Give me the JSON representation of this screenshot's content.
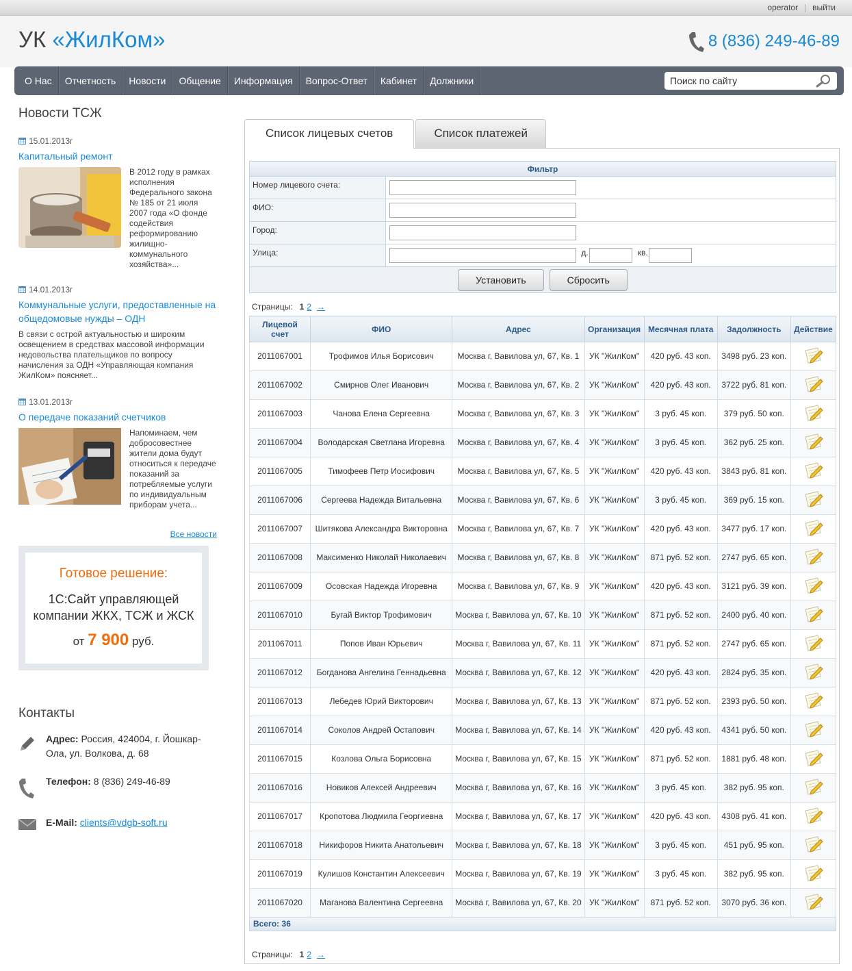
{
  "topbar": {
    "user": "operator",
    "logout": "выйти"
  },
  "logo": {
    "prefix": "УК",
    "name": "«ЖилКом»"
  },
  "header": {
    "phone": "8 (836) 249-46-89"
  },
  "nav": [
    "О Нас",
    "Отчетность",
    "Новости",
    "Общение",
    "Информация",
    "Вопрос-Ответ",
    "Кабинет",
    "Должники"
  ],
  "search": {
    "placeholder": "Поиск по сайту"
  },
  "news_section": {
    "title": "Новости ТСЖ",
    "all_link": "Все новости"
  },
  "news": [
    {
      "date": "15.01.2013г",
      "title": "Капитальный ремонт",
      "text": "В 2012 году в рамках исполнения Федерального закона № 185 от 21 июля 2007 года «О фонде содействия реформированию жилищно-коммунального хозяйства»..."
    },
    {
      "date": "14.01.2013г",
      "title": "Коммунальные услуги, предоставленные на общедомовые нужды – ОДН",
      "text": "В связи с острой актуальностью и широким освещением в средствах массовой информации недовольства плательщиков по вопросу начисления за ОДН «Управляющая компания ЖилКом» поясняет..."
    },
    {
      "date": "13.01.2013г",
      "title": "О передаче показаний счетчиков",
      "text": "Напоминаем, чем добросовестнее жители дома будут относиться к передаче показаний за потребляемые услуги по индивидуальным приборам учета..."
    }
  ],
  "promo": {
    "heading": "Готовое решение:",
    "body": "1С:Сайт управляющей компании ЖКХ, ТСЖ и ЖСК",
    "price_prefix": "от",
    "price": "7 900",
    "price_suffix": "руб."
  },
  "contacts": {
    "title": "Контакты",
    "address_label": "Адрес:",
    "address": "Россия, 424004, г. Йошкар-Ола, ул. Волкова, д. 68",
    "phone_label": "Телефон:",
    "phone": "8 (836) 249-46-89",
    "email_label": "E-Mail:",
    "email": "clients@vdgb-soft.ru"
  },
  "tabs": {
    "accounts": "Список лицевых счетов",
    "payments": "Список платежей"
  },
  "filter": {
    "title": "Фильтр",
    "account": "Номер лицевого счета:",
    "fio": "ФИО:",
    "city": "Город:",
    "street": "Улица:",
    "house": "д.",
    "flat": "кв.",
    "apply": "Установить",
    "reset": "Сбросить"
  },
  "pager": {
    "label": "Страницы:",
    "current": "1",
    "next_page": "2",
    "arrow": "→"
  },
  "table": {
    "headers": [
      "Лицевой счет",
      "ФИО",
      "Адрес",
      "Организация",
      "Месячная плата",
      "Задолжность",
      "Действие"
    ],
    "rows": [
      [
        "2011067001",
        "Трофимов Илья Борисович",
        "Москва г, Вавилова ул, 67, Кв. 1",
        "УК \"ЖилКом\"",
        "420 руб. 43 коп.",
        "3498 руб. 23 коп."
      ],
      [
        "2011067002",
        "Смирнов Олег Иванович",
        "Москва г, Вавилова ул, 67, Кв. 2",
        "УК \"ЖилКом\"",
        "420 руб. 43 коп.",
        "3722 руб. 81 коп."
      ],
      [
        "2011067003",
        "Чанова Елена Сергеевна",
        "Москва г, Вавилова ул, 67, Кв. 3",
        "УК \"ЖилКом\"",
        "3 руб. 45 коп.",
        "379 руб. 50 коп."
      ],
      [
        "2011067004",
        "Володарская Светлана Игоревна",
        "Москва г, Вавилова ул, 67, Кв. 4",
        "УК \"ЖилКом\"",
        "3 руб. 45 коп.",
        "362 руб. 25 коп."
      ],
      [
        "2011067005",
        "Тимофеев Петр Иосифович",
        "Москва г, Вавилова ул, 67, Кв. 5",
        "УК \"ЖилКом\"",
        "420 руб. 43 коп.",
        "3843 руб. 81 коп."
      ],
      [
        "2011067006",
        "Сергеева Надежда Витальевна",
        "Москва г, Вавилова ул, 67, Кв. 6",
        "УК \"ЖилКом\"",
        "3 руб. 45 коп.",
        "369 руб. 15 коп."
      ],
      [
        "2011067007",
        "Шитякова Александра Викторовна",
        "Москва г, Вавилова ул, 67, Кв. 7",
        "УК \"ЖилКом\"",
        "420 руб. 43 коп.",
        "3477 руб. 17 коп."
      ],
      [
        "2011067008",
        "Максименко Николай Николаевич",
        "Москва г, Вавилова ул, 67, Кв. 8",
        "УК \"ЖилКом\"",
        "871 руб. 52 коп.",
        "2747 руб. 65 коп."
      ],
      [
        "2011067009",
        "Осовская Надежда Игоревна",
        "Москва г, Вавилова ул, 67, Кв. 9",
        "УК \"ЖилКом\"",
        "420 руб. 43 коп.",
        "3121 руб. 39 коп."
      ],
      [
        "2011067010",
        "Бугай Виктор Трофимович",
        "Москва г, Вавилова ул, 67, Кв. 10",
        "УК \"ЖилКом\"",
        "871 руб. 52 коп.",
        "2400 руб. 40 коп."
      ],
      [
        "2011067011",
        "Попов Иван Юрьевич",
        "Москва г, Вавилова ул, 67, Кв. 11",
        "УК \"ЖилКом\"",
        "871 руб. 52 коп.",
        "2747 руб. 65 коп."
      ],
      [
        "2011067012",
        "Богданова Ангелина Геннадьевна",
        "Москва г, Вавилова ул, 67, Кв. 12",
        "УК \"ЖилКом\"",
        "420 руб. 43 коп.",
        "2824 руб. 35 коп."
      ],
      [
        "2011067013",
        "Лебедев Юрий Викторович",
        "Москва г, Вавилова ул, 67, Кв. 13",
        "УК \"ЖилКом\"",
        "871 руб. 52 коп.",
        "2393 руб. 50 коп."
      ],
      [
        "2011067014",
        "Соколов Андрей Остапович",
        "Москва г, Вавилова ул, 67, Кв. 14",
        "УК \"ЖилКом\"",
        "420 руб. 43 коп.",
        "4341 руб. 50 коп."
      ],
      [
        "2011067015",
        "Козлова Ольга Борисовна",
        "Москва г, Вавилова ул, 67, Кв. 15",
        "УК \"ЖилКом\"",
        "871 руб. 52 коп.",
        "1881 руб. 48 коп."
      ],
      [
        "2011067016",
        "Новиков Алексей Андреевич",
        "Москва г, Вавилова ул, 67, Кв. 16",
        "УК \"ЖилКом\"",
        "3 руб. 45 коп.",
        "382 руб. 95 коп."
      ],
      [
        "2011067017",
        "Кропотова Людмила Георгиевна",
        "Москва г, Вавилова ул, 67, Кв. 17",
        "УК \"ЖилКом\"",
        "420 руб. 43 коп.",
        "4308 руб. 41 коп."
      ],
      [
        "2011067018",
        "Никифоров Никита Анатольевич",
        "Москва г, Вавилова ул, 67, Кв. 18",
        "УК \"ЖилКом\"",
        "3 руб. 45 коп.",
        "451 руб. 95 коп."
      ],
      [
        "2011067019",
        "Кулишов Константин Алексеевич",
        "Москва г, Вавилова ул, 67, Кв. 19",
        "УК \"ЖилКом\"",
        "3 руб. 45 коп.",
        "382 руб. 95 коп."
      ],
      [
        "2011067020",
        "Маганова Валентина Сергеевна",
        "Москва г, Вавилова ул, 67, Кв. 20",
        "УК \"ЖилКом\"",
        "871 руб. 52 коп.",
        "3070 руб. 36 коп."
      ]
    ],
    "total": "Всего: 36"
  },
  "icons": {
    "phone": "phone-icon",
    "calendar": "calendar-icon",
    "search": "search-icon",
    "edit": "edit-icon",
    "pencil": "pencil-icon",
    "mail": "mail-icon"
  },
  "colors": {
    "accent": "#1a8ad6",
    "nav": "#5d6472",
    "promo": "#f06d0c"
  }
}
